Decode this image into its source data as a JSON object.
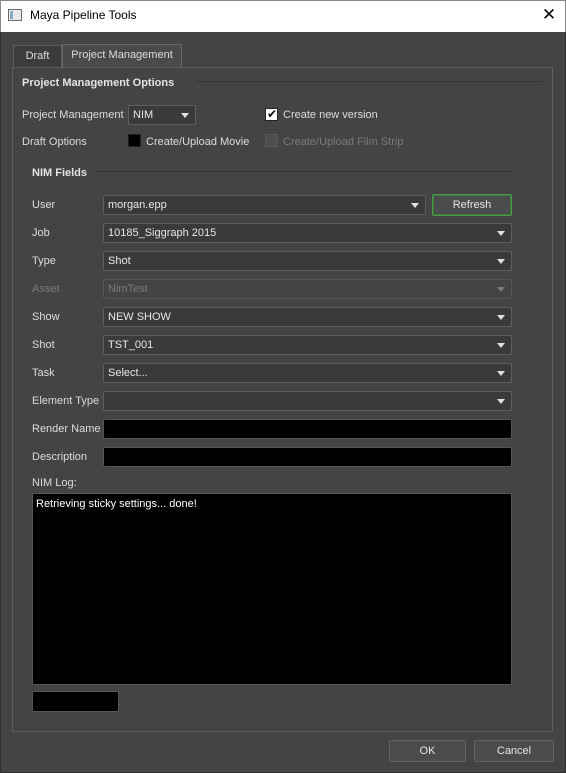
{
  "window": {
    "title": "Maya Pipeline Tools",
    "close_glyph": "✕"
  },
  "tabs": [
    {
      "label": "Draft"
    },
    {
      "label": "Project Management"
    }
  ],
  "pm_options": {
    "section_title": "Project Management Options",
    "pm_label": "Project Management",
    "pm_value": "NIM",
    "create_new_version": {
      "label": "Create new version",
      "checked": true
    },
    "draft_options_label": "Draft Options",
    "create_upload_movie": {
      "label": "Create/Upload Movie",
      "checked": false
    },
    "create_upload_film_strip": {
      "label": "Create/Upload Film Strip",
      "enabled": false
    }
  },
  "nim_fields": {
    "section_title": "NIM Fields",
    "user": {
      "label": "User",
      "value": "morgan.epp"
    },
    "refresh_label": "Refresh",
    "job": {
      "label": "Job",
      "value": "10185_Siggraph 2015"
    },
    "type": {
      "label": "Type",
      "value": "Shot"
    },
    "asset": {
      "label": "Asset",
      "value": "NimTest"
    },
    "show": {
      "label": "Show",
      "value": "NEW SHOW"
    },
    "shot": {
      "label": "Shot",
      "value": "TST_001"
    },
    "task": {
      "label": "Task",
      "value": "Select..."
    },
    "element_type": {
      "label": "Element Type",
      "value": ""
    },
    "render_name": {
      "label": "Render Name",
      "value": ""
    },
    "description": {
      "label": "Description",
      "value": ""
    },
    "log_label": "NIM Log:",
    "log_text": "Retrieving sticky settings... done!"
  },
  "footer": {
    "ok_label": "OK",
    "cancel_label": "Cancel"
  }
}
